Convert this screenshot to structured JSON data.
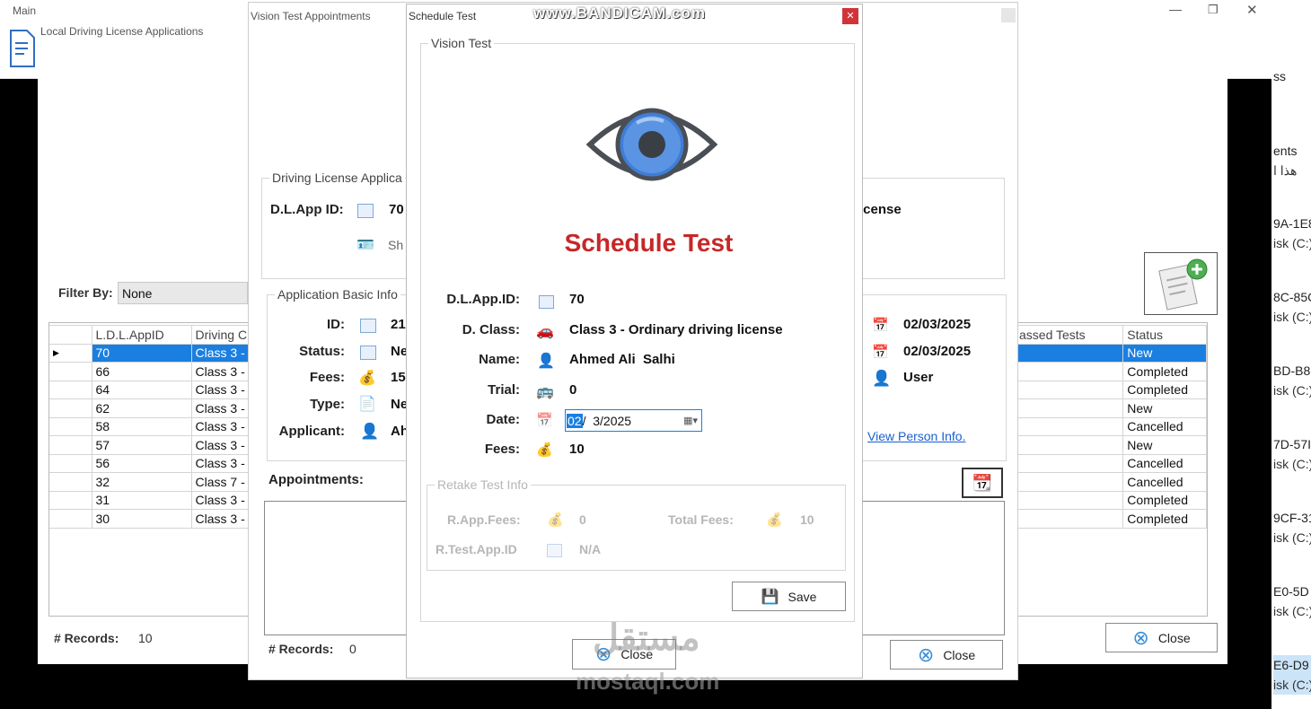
{
  "main_window": {
    "title": "Main"
  },
  "ldla_form": {
    "title": "Local Driving License Applications",
    "filter_label": "Filter By:",
    "filter_value": "None",
    "columns": [
      "L.D.L.AppID",
      "Driving C"
    ],
    "rows": [
      [
        "70",
        "Class 3 -"
      ],
      [
        "66",
        "Class 3 -"
      ],
      [
        "64",
        "Class 3 -"
      ],
      [
        "62",
        "Class 3 -"
      ],
      [
        "58",
        "Class 3 -"
      ],
      [
        "57",
        "Class 3 -"
      ],
      [
        "56",
        "Class 3 -"
      ],
      [
        "32",
        "Class 7 -"
      ],
      [
        "31",
        "Class 3 -"
      ],
      [
        "30",
        "Class 3 -"
      ]
    ],
    "right_columns": [
      "assed Tests",
      "Status"
    ],
    "status": [
      "New",
      "Completed",
      "Completed",
      "New",
      "Cancelled",
      "New",
      "Cancelled",
      "Cancelled",
      "Completed",
      "Completed"
    ],
    "records_label": "# Records:",
    "records_value": "10",
    "close_label": "Close"
  },
  "vta_form": {
    "title": "Vision Test Appointments",
    "dla_group": "Driving License Applica",
    "dlapp_label": "D.L.App ID:",
    "dlapp_value": "70",
    "license_partial": "icense",
    "show_partial": "Sh",
    "abi_group": "Application Basic Info",
    "id_label": "ID:",
    "id_value": "21",
    "status_label": "Status:",
    "status_value": "Ne",
    "fees_label": "Fees:",
    "fees_value": "15",
    "type_label": "Type:",
    "type_value": "Ne",
    "applicant_label": "Applicant:",
    "applicant_value": "Ah",
    "date1": "02/03/2025",
    "date2": "02/03/2025",
    "user": "User",
    "view_person": "View Person Info.",
    "appointments_label": "Appointments:",
    "records_label": "# Records:",
    "records_value": "0",
    "close_label": "Close"
  },
  "schedule": {
    "title": "Schedule Test",
    "group": "Vision Test",
    "heading": "Schedule Test",
    "dlapp_label": "D.L.App.ID:",
    "dlapp_value": "70",
    "class_label": "D. Class:",
    "class_value": "Class 3 - Ordinary driving license",
    "name_label": "Name:",
    "name_value": "Ahmed Ali  Salhi",
    "trial_label": "Trial:",
    "trial_value": "0",
    "date_label": "Date:",
    "date_sel": "02",
    "date_rest": "/  3/2025",
    "fees_label": "Fees:",
    "fees_value": "10",
    "retake_group": "Retake Test Info",
    "rapp_label": "R.App.Fees:",
    "rapp_value": "0",
    "total_label": "Total Fees:",
    "total_value": "10",
    "rtest_label": "R.Test.App.ID",
    "rtest_value": "N/A",
    "save_label": "Save",
    "close_label": "Close"
  },
  "explorer": {
    "items": [
      {
        "a": "ss",
        "b": ""
      },
      {
        "a": "ents",
        "b": "هذا  ا"
      },
      {
        "a": "9A-1E8",
        "b": "isk (C:)"
      },
      {
        "a": "8C-85C",
        "b": "isk (C:)"
      },
      {
        "a": "BD-B8",
        "b": "isk (C:)"
      },
      {
        "a": "7D-57I",
        "b": "isk (C:)"
      },
      {
        "a": "9CF-31",
        "b": "isk (C:)"
      },
      {
        "a": "E0-5D",
        "b": "isk (C:)"
      },
      {
        "a": "E6-D9",
        "b": "isk (C:)"
      }
    ]
  },
  "watermark": {
    "brand": "www.BANDICAM.com",
    "site_ar": "مستقل",
    "site": "mostaql.com"
  },
  "colors": {
    "accent": "#c62828",
    "selection": "#1a7fe0",
    "link": "#1a5fd0"
  }
}
